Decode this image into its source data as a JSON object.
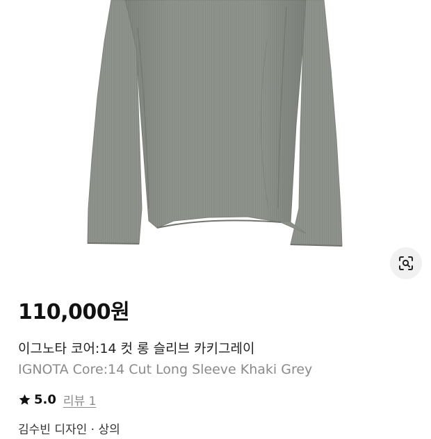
{
  "product": {
    "price": "110,000원",
    "name_ko": "이그노타 코어:14 컷 롱 슬리브 카키그레이",
    "name_en": "IGNOTA Core:14 Cut Long Sleeve Khaki Grey",
    "rating": "5.0",
    "review_link": "리뷰 1",
    "partial_text": "김수빈 디자인 · 상의"
  },
  "image": {
    "subject": "khaki grey long sleeve top",
    "garment_color": "#8f938d",
    "lens_icon": "lens-search-icon"
  },
  "colors": {
    "text_primary": "#111111",
    "text_secondary": "#8a8a8a",
    "star": "#111111",
    "lens_bg": "#f1f1f1"
  }
}
